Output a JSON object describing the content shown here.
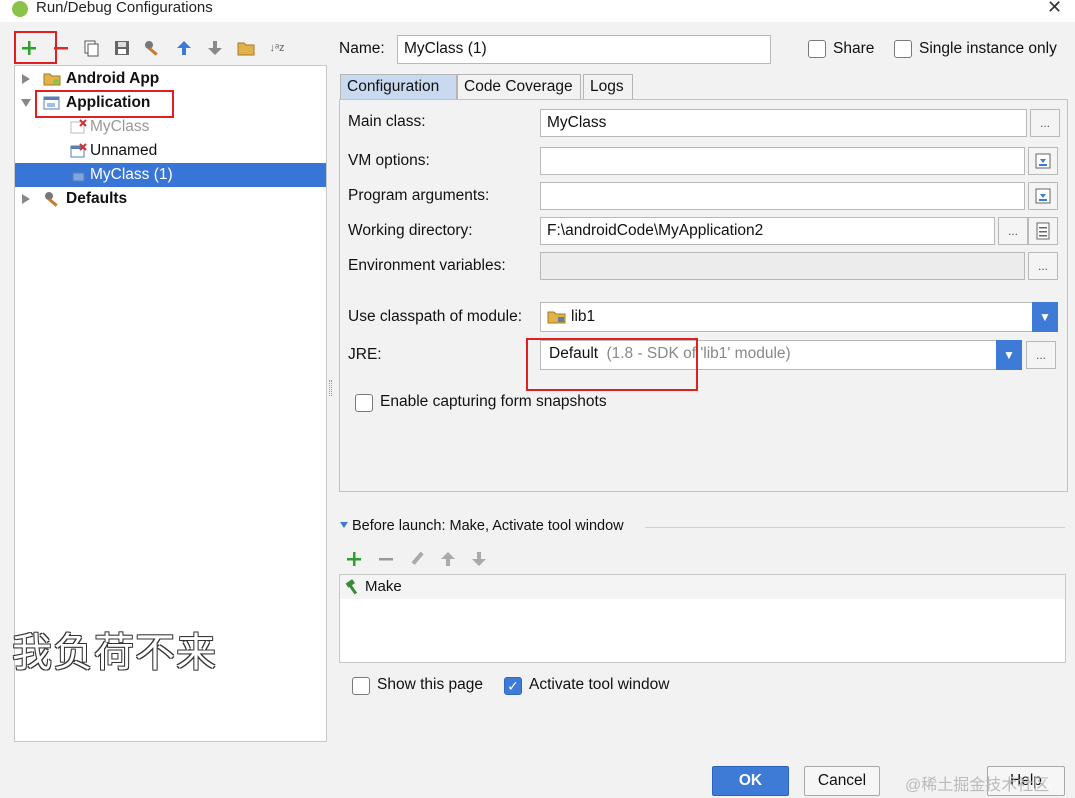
{
  "window": {
    "title": "Run/Debug Configurations",
    "close_glyph": "✕"
  },
  "toolbar": {
    "icons": [
      "add-icon",
      "remove-icon",
      "copy-icon",
      "save-icon",
      "wrench-icon",
      "move-up-icon",
      "move-down-icon",
      "folder-icon",
      "sort-alpha-icon"
    ],
    "sort_glyph": "↓ᵃz"
  },
  "tree": {
    "items": [
      {
        "label": "Android App"
      },
      {
        "label": "Application"
      },
      {
        "label": "MyClass"
      },
      {
        "label": "Unnamed"
      },
      {
        "label": "MyClass (1)"
      },
      {
        "label": "Defaults"
      }
    ]
  },
  "header": {
    "name_label": "Name:",
    "name_value": "MyClass (1)",
    "share_label": "Share",
    "single_instance_label": "Single instance only"
  },
  "tabs": [
    {
      "label": "Configuration",
      "active": true
    },
    {
      "label": "Code Coverage",
      "active": false
    },
    {
      "label": "Logs",
      "active": false
    }
  ],
  "config": {
    "main_class_label": "Main class:",
    "main_class_value": "MyClass",
    "vm_options_label": "VM options:",
    "vm_options_value": "",
    "program_args_label": "Program arguments:",
    "program_args_value": "",
    "working_dir_label": "Working directory:",
    "working_dir_value": "F:\\androidCode\\MyApplication2",
    "env_vars_label": "Environment variables:",
    "env_vars_value": "",
    "classpath_label": "Use classpath of module:",
    "classpath_value": "lib1",
    "jre_label": "JRE:",
    "jre_value": "Default",
    "jre_hint": "(1.8 - SDK of 'lib1' module)",
    "snapshots_label": "Enable capturing form snapshots",
    "ellipsis": "...",
    "dropdown_glyph": "▼"
  },
  "before_launch": {
    "title": "Before launch: Make, Activate tool window",
    "items": [
      {
        "label": "Make"
      }
    ]
  },
  "options": {
    "show_page_label": "Show this page",
    "activate_tool_label": "Activate tool window",
    "check_glyph": "✓"
  },
  "buttons": {
    "ok": "OK",
    "cancel": "Cancel",
    "help": "Help"
  },
  "overlay": {
    "watermark": "我负荷不来",
    "site_mark": "@稀土掘金技术社区"
  },
  "colors": {
    "selection": "#3875d7",
    "accent": "#3d7bd6",
    "annotation_red": "#e02020"
  }
}
